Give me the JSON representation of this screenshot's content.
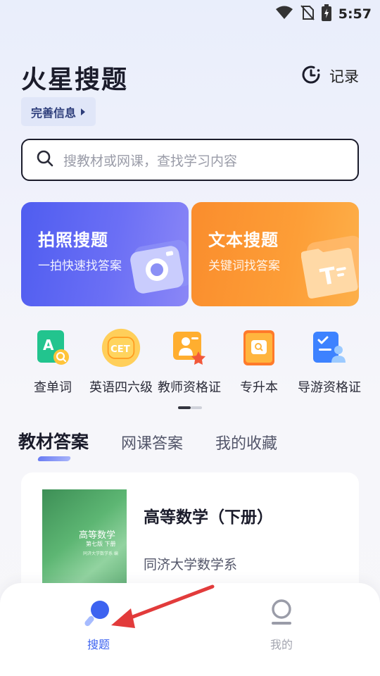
{
  "status_bar": {
    "time": "5:57",
    "icons": [
      "wifi-icon",
      "no-sim-icon",
      "battery-charging-icon"
    ]
  },
  "header": {
    "app_title": "火星搜题",
    "history_label": "记录",
    "history_icon": "history-clock-icon",
    "profile_chip_label": "完善信息",
    "profile_chip_icon": "caret-right-icon"
  },
  "search": {
    "placeholder": "搜教材或网课，查找学习内容",
    "icon": "search-icon"
  },
  "feature_cards": [
    {
      "title": "拍照搜题",
      "subtitle": "一拍快速找答案",
      "icon": "camera-icon",
      "color": "#5b63f2"
    },
    {
      "title": "文本搜题",
      "subtitle": "关键词找答案",
      "icon": "text-folder-icon",
      "color": "#fb932f"
    }
  ],
  "tools": [
    {
      "label": "查单词",
      "icon": "word-lookup-icon"
    },
    {
      "label": "英语四六级",
      "icon": "cet-icon",
      "badge": "CET"
    },
    {
      "label": "教师资格证",
      "icon": "teacher-cert-icon"
    },
    {
      "label": "专升本",
      "icon": "upgrade-book-icon"
    },
    {
      "label": "导游资格证",
      "icon": "guide-cert-icon"
    }
  ],
  "pager": {
    "current": 1,
    "total": 2
  },
  "tabs": [
    {
      "label": "教材答案",
      "active": true
    },
    {
      "label": "网课答案",
      "active": false
    },
    {
      "label": "我的收藏",
      "active": false
    }
  ],
  "book": {
    "title": "高等数学（下册）",
    "author": "同济大学数学系",
    "cover_title": "高等数学",
    "cover_edition": "第七版  下册",
    "cover_publisher": "同济大学数学系 编"
  },
  "bottom_nav": [
    {
      "label": "搜题",
      "icon": "search-tab-icon",
      "active": true
    },
    {
      "label": "我的",
      "icon": "profile-tab-icon",
      "active": false
    }
  ],
  "colors": {
    "accent": "#3d63f0",
    "annotation_arrow": "#e23b3b"
  }
}
